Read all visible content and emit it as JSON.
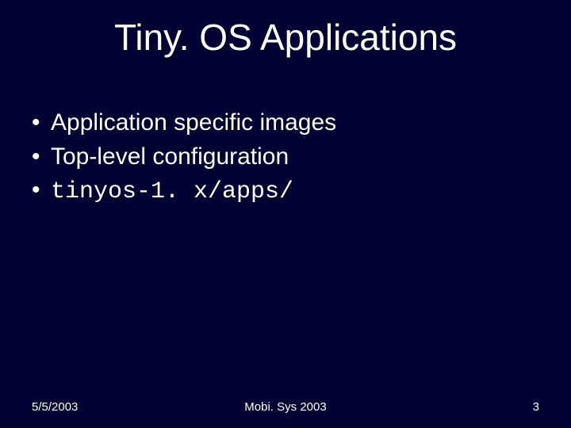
{
  "title": "Tiny. OS Applications",
  "bullets": [
    {
      "text": "Application specific images",
      "mono": false
    },
    {
      "text": "Top-level configuration",
      "mono": false
    },
    {
      "text": "tinyos-1. x/apps/",
      "mono": true
    }
  ],
  "footer": {
    "date": "5/5/2003",
    "venue": "Mobi. Sys 2003",
    "page": "3"
  }
}
